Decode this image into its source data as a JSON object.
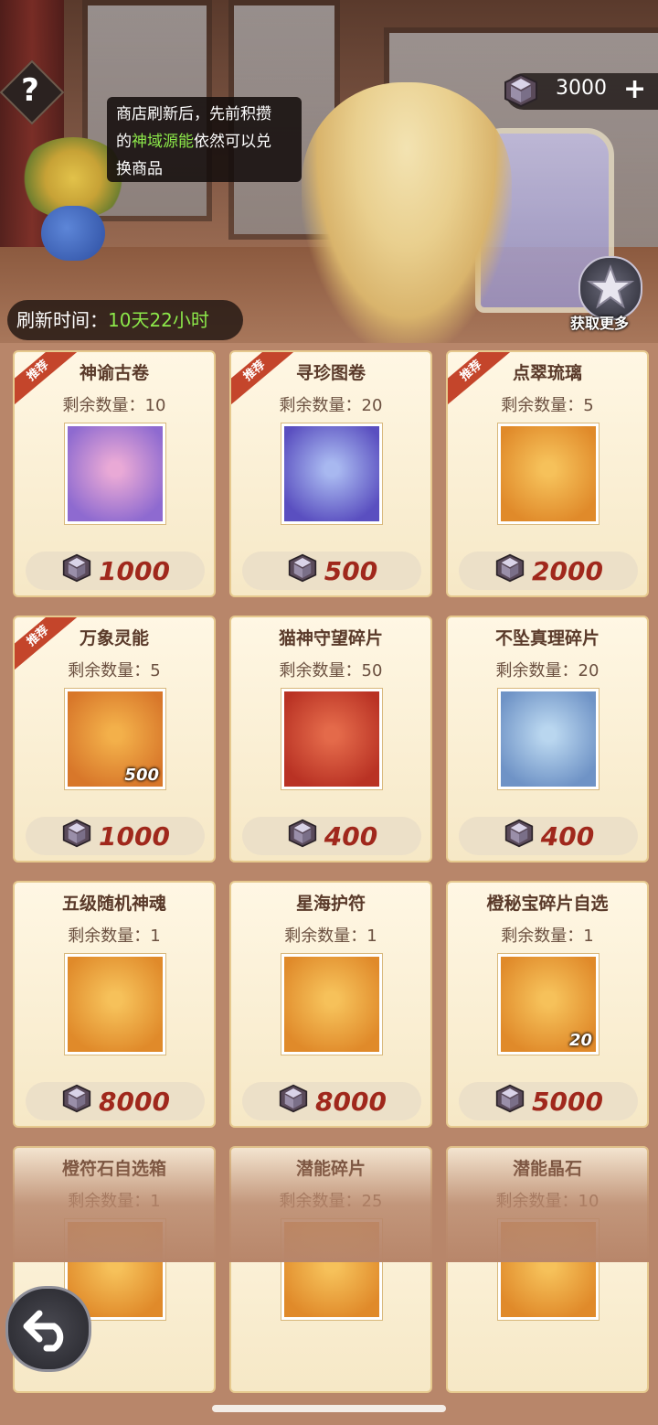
{
  "currency": {
    "amount": "3000",
    "plus": "+"
  },
  "help": {
    "label": "?"
  },
  "tooltip": {
    "line1": "商店刷新后，先前积攒",
    "line2_pre": "的",
    "line2_hl": "神域源能",
    "line2_post": "依然可以兑",
    "line3": "换商品"
  },
  "refresh": {
    "label": "刷新时间：",
    "time": "10天22小时"
  },
  "get_more": {
    "label": "获取更多"
  },
  "ribbon_label": "推荐",
  "items": [
    {
      "name": "神谕古卷",
      "qty": "剩余数量：10",
      "price": "1000",
      "recommended": true,
      "badge": "",
      "colors": [
        "#e9a9d6",
        "#8e6ad0"
      ]
    },
    {
      "name": "寻珍图卷",
      "qty": "剩余数量：20",
      "price": "500",
      "recommended": true,
      "badge": "",
      "colors": [
        "#a8b8f0",
        "#5a4fc0"
      ]
    },
    {
      "name": "点翠琉璃",
      "qty": "剩余数量：5",
      "price": "2000",
      "recommended": true,
      "badge": "",
      "colors": [
        "#f6c15a",
        "#e08a2a"
      ]
    },
    {
      "name": "万象灵能",
      "qty": "剩余数量：5",
      "price": "1000",
      "recommended": true,
      "badge": "500",
      "colors": [
        "#f3b04a",
        "#d8772a"
      ]
    },
    {
      "name": "猫神守望碎片",
      "qty": "剩余数量：50",
      "price": "400",
      "recommended": false,
      "badge": "",
      "colors": [
        "#e46a4a",
        "#b93224"
      ]
    },
    {
      "name": "不坠真理碎片",
      "qty": "剩余数量：20",
      "price": "400",
      "recommended": false,
      "badge": "",
      "colors": [
        "#b9d6ef",
        "#6f93c6"
      ]
    },
    {
      "name": "五级随机神魂",
      "qty": "剩余数量：1",
      "price": "8000",
      "recommended": false,
      "badge": "",
      "colors": [
        "#f6c15a",
        "#e08a2a"
      ]
    },
    {
      "name": "星海护符",
      "qty": "剩余数量：1",
      "price": "8000",
      "recommended": false,
      "badge": "",
      "colors": [
        "#f6c15a",
        "#e08a2a"
      ]
    },
    {
      "name": "橙秘宝碎片自选",
      "qty": "剩余数量：1",
      "price": "5000",
      "recommended": false,
      "badge": "20",
      "colors": [
        "#f6c15a",
        "#e08a2a"
      ]
    },
    {
      "name": "橙符石自选箱",
      "qty": "剩余数量：1",
      "price": "",
      "recommended": false,
      "badge": "",
      "colors": [
        "#f6c15a",
        "#e08a2a"
      ]
    },
    {
      "name": "潜能碎片",
      "qty": "剩余数量：25",
      "price": "",
      "recommended": false,
      "badge": "",
      "colors": [
        "#f6c15a",
        "#e08a2a"
      ]
    },
    {
      "name": "潜能晶石",
      "qty": "剩余数量：10",
      "price": "",
      "recommended": false,
      "badge": "",
      "colors": [
        "#f6c15a",
        "#e08a2a"
      ]
    }
  ]
}
